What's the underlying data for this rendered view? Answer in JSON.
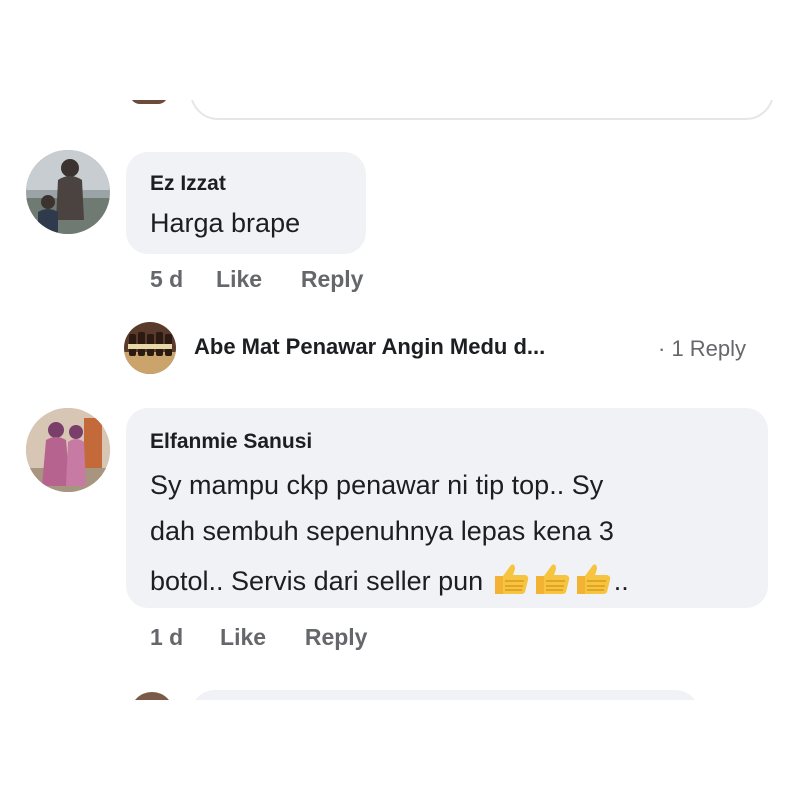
{
  "comments": [
    {
      "author": "Ez Izzat",
      "text": "Harga brape",
      "age": "5 d",
      "like_label": "Like",
      "reply_label": "Reply",
      "avatar_icon": "user-photo-icon"
    },
    {
      "author": "Elfanmie Sanusi",
      "text_line1": "Sy mampu ckp penawar ni tip top.. Sy",
      "text_line2": "dah sembuh sepenuhnya lepas kena 3",
      "text_line3": "botol.. Servis dari seller pun",
      "text_suffix": "..",
      "emoji": "thumbs-up-emoji x3",
      "age": "1 d",
      "like_label": "Like",
      "reply_label": "Reply",
      "avatar_icon": "user-photo-icon"
    }
  ],
  "reply_preview": {
    "name": "Abe Mat Penawar Angin Medu d...",
    "count": "· 1 Reply",
    "avatar_icon": "bottles-page-icon"
  },
  "colors": {
    "bubble": "#f0f2f5",
    "meta_text": "#65676b",
    "author_text": "#1c1e21"
  }
}
